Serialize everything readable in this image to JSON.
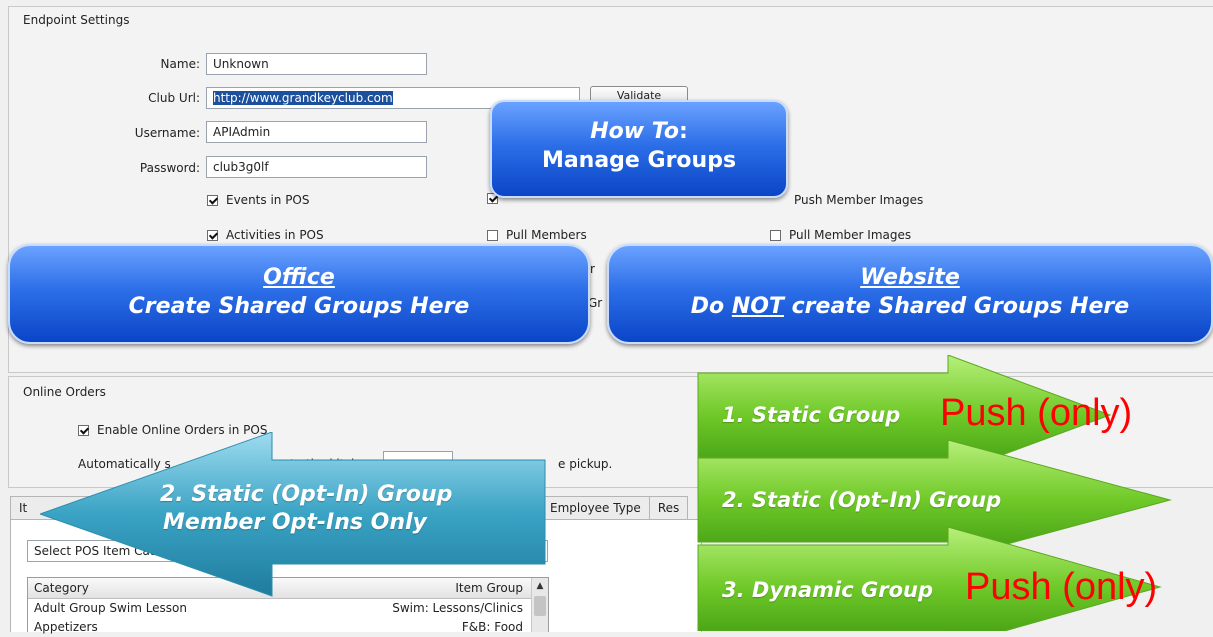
{
  "endpoint_settings": {
    "title": "Endpoint Settings",
    "name_label": "Name:",
    "name_value": "Unknown",
    "club_url_label": "Club Url:",
    "club_url_value": "http://www.grandkeyclub.com",
    "validate_label": "Validate",
    "username_label": "Username:",
    "username_value": "APIAdmin",
    "password_label": "Password:",
    "password_value": "club3g0lf",
    "checkboxes": {
      "events_in_pos": {
        "label": "Events in POS",
        "checked": true
      },
      "activities_in_pos": {
        "label": "Activities in POS",
        "checked": true
      },
      "pull_members": {
        "label": "Pull Members",
        "checked": false
      },
      "push_member_images": {
        "label": "Push Member Images",
        "checked": false
      },
      "pull_member_images": {
        "label": "Pull Member Images",
        "checked": false
      }
    },
    "partial_r": "r",
    "partial_gr": "Gr"
  },
  "online_orders": {
    "title": "Online Orders",
    "enable_label": "Enable Online Orders in POS",
    "enable_checked": true,
    "auto_prefix": "Automatically s",
    "auto_middle": "to the kitch",
    "auto_suffix": "e pickup."
  },
  "tabs": {
    "left_partial": "It",
    "employee_type": "Employee Type",
    "res_partial": "Res"
  },
  "category_select": {
    "value": "Select POS Item Categ"
  },
  "grid": {
    "headers": {
      "category": "Category",
      "item_group": "Item Group"
    },
    "rows": [
      {
        "category": "Adult Group Swim Lesson",
        "item_group": "Swim: Lessons/Clinics"
      },
      {
        "category": "Appetizers",
        "item_group": "F&B: Food"
      }
    ]
  },
  "overlays": {
    "how_to_line1": "How To",
    "how_to_colon": ":",
    "how_to_line2": "Manage Groups",
    "office_title": "Office",
    "office_sub": "Create Shared Groups Here",
    "website_title": "Website",
    "website_sub_pre": "Do ",
    "website_sub_not": "NOT",
    "website_sub_post": " create Shared Groups Here",
    "arrow_left_line1": "2. Static (Opt-In) Group",
    "arrow_left_line2": "Member Opt-Ins Only",
    "arrow1_label": "1. Static Group",
    "arrow1_push": "Push (only)",
    "arrow2_label": "2. Static (Opt-In) Group",
    "arrow3_label": "3. Dynamic Group",
    "arrow3_push": "Push (only)"
  },
  "colors": {
    "bubble_blue": "#2d6fe8",
    "arrow_green": "#6fc928",
    "arrow_teal": "#3aa3c4",
    "push_red": "#ff0000"
  }
}
